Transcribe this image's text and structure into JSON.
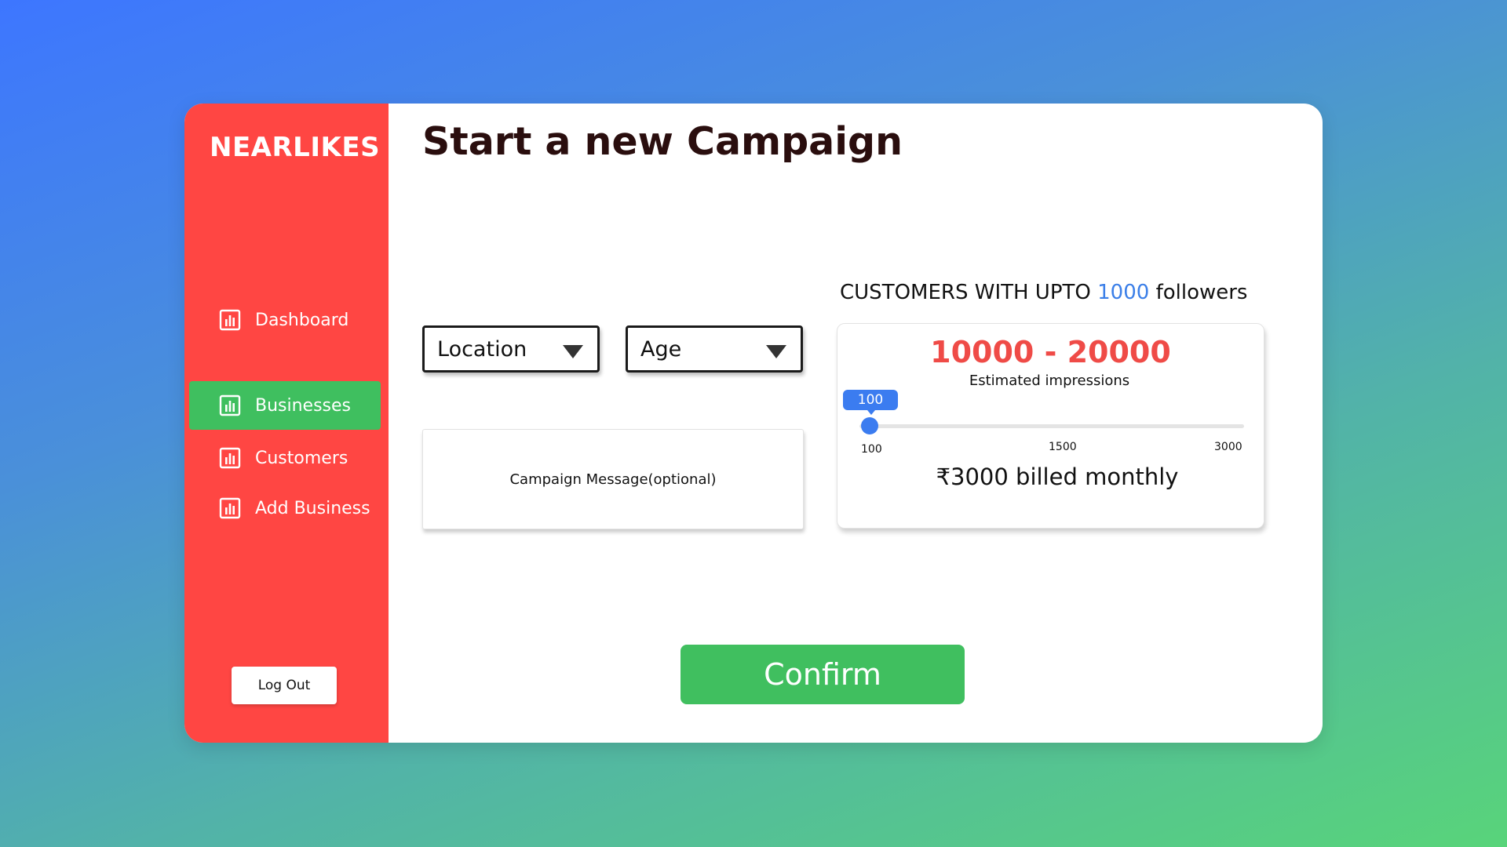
{
  "brand": "NEARLIKES",
  "nav": {
    "items": [
      {
        "label": "Dashboard",
        "icon": "bar-chart-icon",
        "active": false
      },
      {
        "label": "Businesses",
        "icon": "bar-chart-icon",
        "active": true
      },
      {
        "label": "Customers",
        "icon": "bar-chart-icon",
        "active": false
      },
      {
        "label": "Add Business",
        "icon": "bar-chart-icon",
        "active": false
      }
    ],
    "logout_label": "Log Out"
  },
  "page_title": "Start a new Campaign",
  "filters": {
    "location": {
      "value": "Location"
    },
    "age": {
      "value": "Age"
    }
  },
  "message": {
    "placeholder": "Campaign Message(optional)"
  },
  "customers": {
    "heading_prefix": "CUSTOMERS WITH UPTO",
    "heading_count": "1000",
    "heading_suffix": "followers",
    "impressions_range": "10000 - 20000",
    "impressions_label": "Estimated impressions",
    "slider": {
      "value": "100",
      "min": 100,
      "max": 3000,
      "ticks": [
        "100",
        "1500",
        "3000"
      ]
    },
    "billing": "₹3000 billed monthly"
  },
  "confirm_label": "Confirm",
  "colors": {
    "sidebar": "#ff4643",
    "active_nav": "#3fbf5f",
    "accent_blue": "#3b7cf0",
    "impressions_red": "#ef4b47",
    "confirm_green": "#40bf5f"
  }
}
